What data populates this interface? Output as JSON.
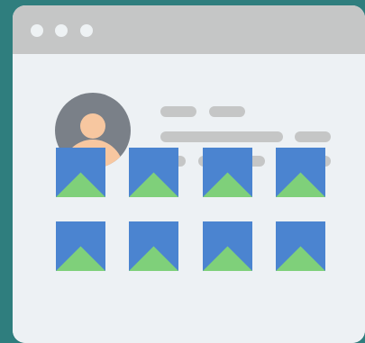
{
  "theme": {
    "background": "#2f7e7e",
    "window_bg": "#edf1f4",
    "titlebar_bg": "#c5c6c6",
    "placeholder_gray": "#c5c6c6",
    "avatar_bg": "#7a8088",
    "avatar_skin": "#f7c7a0",
    "image_sky": "#4b84d0",
    "image_hill": "#7fd07a"
  },
  "icons": {
    "window_controls": [
      "window-control-dot",
      "window-control-dot",
      "window-control-dot"
    ],
    "avatar": "user-avatar-icon",
    "image_placeholder": "image-placeholder-icon"
  },
  "gallery": {
    "tiles": [
      {
        "icon": "image-placeholder-icon"
      },
      {
        "icon": "image-placeholder-icon"
      },
      {
        "icon": "image-placeholder-icon"
      },
      {
        "icon": "image-placeholder-icon"
      },
      {
        "icon": "image-placeholder-icon"
      },
      {
        "icon": "image-placeholder-icon"
      },
      {
        "icon": "image-placeholder-icon"
      },
      {
        "icon": "image-placeholder-icon"
      }
    ]
  }
}
